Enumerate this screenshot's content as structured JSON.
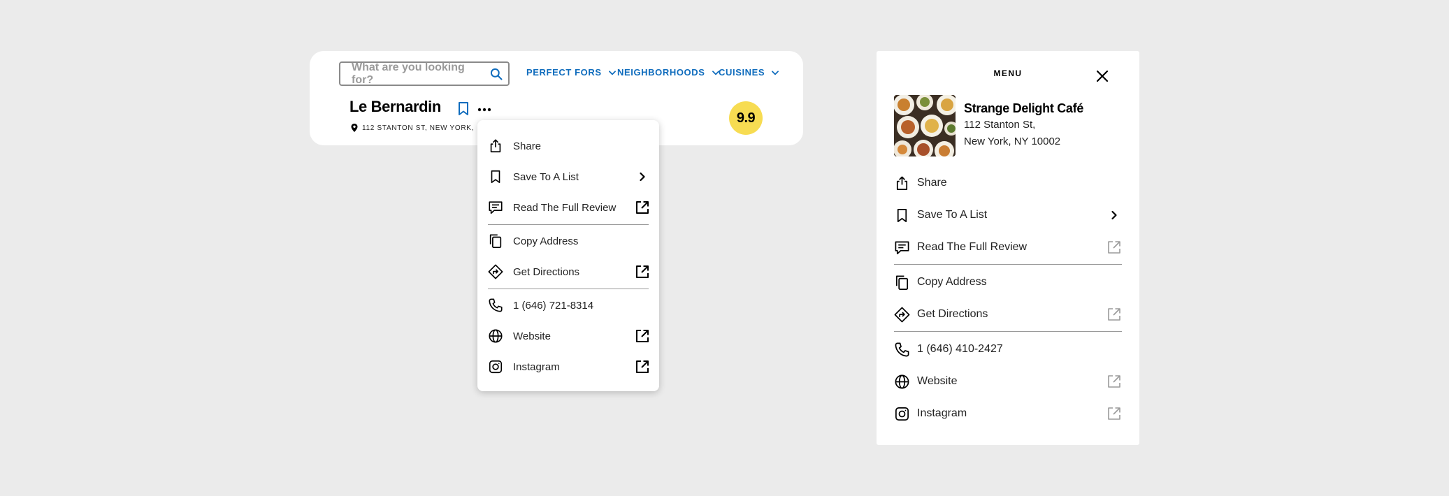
{
  "colors": {
    "accent_blue": "#0f6cbd",
    "rating_yellow": "#f7dc52",
    "page_bg": "#ebebeb",
    "muted_icon": "#9a9a9a"
  },
  "header": {
    "search_placeholder": "What are you looking for?",
    "nav": [
      {
        "label": "PERFECT FORS",
        "icon": "chevron-down-icon"
      },
      {
        "label": "NEIGHBORHOODS",
        "icon": "chevron-down-icon"
      },
      {
        "label": "CUISINES",
        "icon": "chevron-down-icon"
      }
    ]
  },
  "restaurant": {
    "name": "Le Bernardin",
    "address": "112 STANTON ST, NEW YORK, NY 10002",
    "rating": "9.9"
  },
  "dropdown": {
    "items": [
      {
        "label": "Share",
        "icon": "share-icon"
      },
      {
        "label": "Save To A List",
        "icon": "bookmark-icon",
        "trailing": "chevron-right-icon"
      },
      {
        "label": "Read The Full Review",
        "icon": "review-icon",
        "trailing": "external-link-icon"
      },
      {
        "label": "Copy Address",
        "icon": "copy-icon"
      },
      {
        "label": "Get Directions",
        "icon": "directions-icon",
        "trailing": "external-link-icon"
      },
      {
        "label": "1 (646) 721-8314",
        "icon": "phone-icon"
      },
      {
        "label": "Website",
        "icon": "globe-icon",
        "trailing": "external-link-icon"
      },
      {
        "label": "Instagram",
        "icon": "instagram-icon",
        "trailing": "external-link-icon"
      }
    ]
  },
  "panel": {
    "title": "MENU",
    "restaurant_name": "Strange Delight Café",
    "address_line1": "112 Stanton St,",
    "address_line2": "New York, NY 10002",
    "items": [
      {
        "label": "Share",
        "icon": "share-icon"
      },
      {
        "label": "Save To A List",
        "icon": "bookmark-icon",
        "trailing": "chevron-right-icon"
      },
      {
        "label": "Read The Full Review",
        "icon": "review-icon",
        "trailing": "external-link-icon"
      },
      {
        "label": "Copy Address",
        "icon": "copy-icon"
      },
      {
        "label": "Get Directions",
        "icon": "directions-icon",
        "trailing": "external-link-icon"
      },
      {
        "label": "1 (646) 410-2427",
        "icon": "phone-icon"
      },
      {
        "label": "Website",
        "icon": "globe-icon",
        "trailing": "external-link-icon"
      },
      {
        "label": "Instagram",
        "icon": "instagram-icon",
        "trailing": "external-link-icon"
      }
    ]
  }
}
